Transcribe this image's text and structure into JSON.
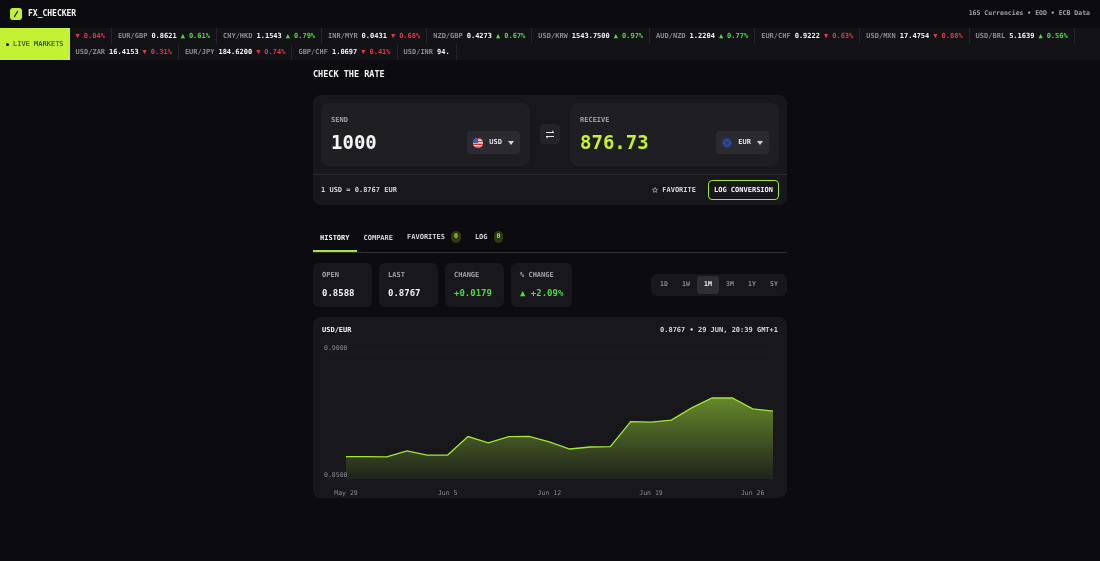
{
  "header": {
    "logo_text": "FX_CHECKER",
    "info": "165 Currencies • EOD • ECB Data"
  },
  "ticker": {
    "badge": "LIVE MARKETS",
    "items": [
      {
        "arrow": "▼",
        "change": "0.84%",
        "color": "#e0394a"
      },
      {
        "pair": "EUR/GBP",
        "rate": "0.8621",
        "arrow": "▲",
        "change": "0.61%",
        "color": "#4ade40"
      },
      {
        "pair": "CNY/HKD",
        "rate": "1.1543",
        "arrow": "▲",
        "change": "0.79%",
        "color": "#4ade40"
      },
      {
        "pair": "INR/MYR",
        "rate": "0.0431",
        "arrow": "▼",
        "change": "0.68%",
        "color": "#e0394a"
      },
      {
        "pair": "NZD/GBP",
        "rate": "0.4273",
        "arrow": "▲",
        "change": "0.67%",
        "color": "#4ade40"
      },
      {
        "pair": "USD/KRW",
        "rate": "1543.7500",
        "arrow": "▲",
        "change": "0.97%",
        "color": "#4ade40"
      },
      {
        "pair": "AUD/NZD",
        "rate": "1.2204",
        "arrow": "▲",
        "change": "0.77%",
        "color": "#4ade40"
      },
      {
        "pair": "EUR/CHF",
        "rate": "0.9222",
        "arrow": "▼",
        "change": "0.63%",
        "color": "#e0394a"
      },
      {
        "pair": "USD/MXN",
        "rate": "17.4754",
        "arrow": "▼",
        "change": "0.88%",
        "color": "#e0394a"
      },
      {
        "pair": "USD/BRL",
        "rate": "5.1639",
        "arrow": "▲",
        "change": "0.56%",
        "color": "#4ade40"
      },
      {
        "pair": "USD/ZAR",
        "rate": "16.4153",
        "arrow": "▼",
        "change": "0.31%",
        "color": "#e0394a"
      },
      {
        "pair": "EUR/JPY",
        "rate": "184.6200",
        "arrow": "▼",
        "change": "0.74%",
        "color": "#e0394a"
      },
      {
        "pair": "GBP/CHF",
        "rate": "1.0697",
        "arrow": "▼",
        "change": "0.41%",
        "color": "#e0394a"
      },
      {
        "pair": "USD/INR",
        "rate": "94."
      }
    ]
  },
  "converter": {
    "title": "CHECK THE RATE",
    "send": {
      "label": "SEND",
      "value": "1000",
      "currency": "USD",
      "kind": "us"
    },
    "receive": {
      "label": "RECEIVE",
      "value": "876.73",
      "currency": "EUR",
      "kind": "eu"
    },
    "rate_text": "1 USD = 0.8767 EUR",
    "favorite_label": "FAVORITE",
    "log_button": "LOG CONVERSION"
  },
  "tabs": [
    {
      "label": "HISTORY",
      "selected": true
    },
    {
      "label": "COMPARE",
      "selected": false
    },
    {
      "label": "FAVORITES",
      "count": "0",
      "selected": false
    },
    {
      "label": "LOG",
      "count": "0",
      "selected": false
    }
  ],
  "stats": [
    {
      "label": "OPEN",
      "value": "0.8588",
      "kind": "plain"
    },
    {
      "label": "LAST",
      "value": "0.8767",
      "kind": "plain"
    },
    {
      "label": "CHANGE",
      "value": "+0.0179",
      "kind": "positive"
    },
    {
      "label": "% CHANGE",
      "value": "▲ +2.09%",
      "kind": "positive"
    }
  ],
  "ranges": [
    {
      "label": "1D",
      "selected": false
    },
    {
      "label": "1W",
      "selected": false
    },
    {
      "label": "1M",
      "selected": true
    },
    {
      "label": "3M",
      "selected": false
    },
    {
      "label": "1Y",
      "selected": false
    },
    {
      "label": "5Y",
      "selected": false
    }
  ],
  "chart_card": {
    "title": "USD/EUR",
    "status": "0.8767 • 29 JUN, 20:39 GMT+1",
    "chart_data": {
      "type": "area",
      "categories": [
        "May 29",
        null,
        null,
        null,
        null,
        "Jun 5",
        null,
        null,
        null,
        null,
        "Jun 12",
        null,
        null,
        null,
        null,
        "Jun 19",
        null,
        null,
        null,
        null,
        "Jun 26",
        null
      ],
      "values": [
        0.8588,
        0.8588,
        0.8587,
        0.8611,
        0.8594,
        0.8594,
        0.8667,
        0.8642,
        0.8667,
        0.8668,
        0.8646,
        0.8618,
        0.8626,
        0.8627,
        0.8726,
        0.8724,
        0.8732,
        0.878,
        0.8819,
        0.8819,
        0.8776,
        0.8767
      ],
      "ylim": [
        0.85,
        0.9
      ],
      "yticks": [
        {
          "value": 0.85,
          "label": "0.8500"
        },
        {
          "value": 0.9,
          "label": "0.9000"
        }
      ]
    }
  }
}
